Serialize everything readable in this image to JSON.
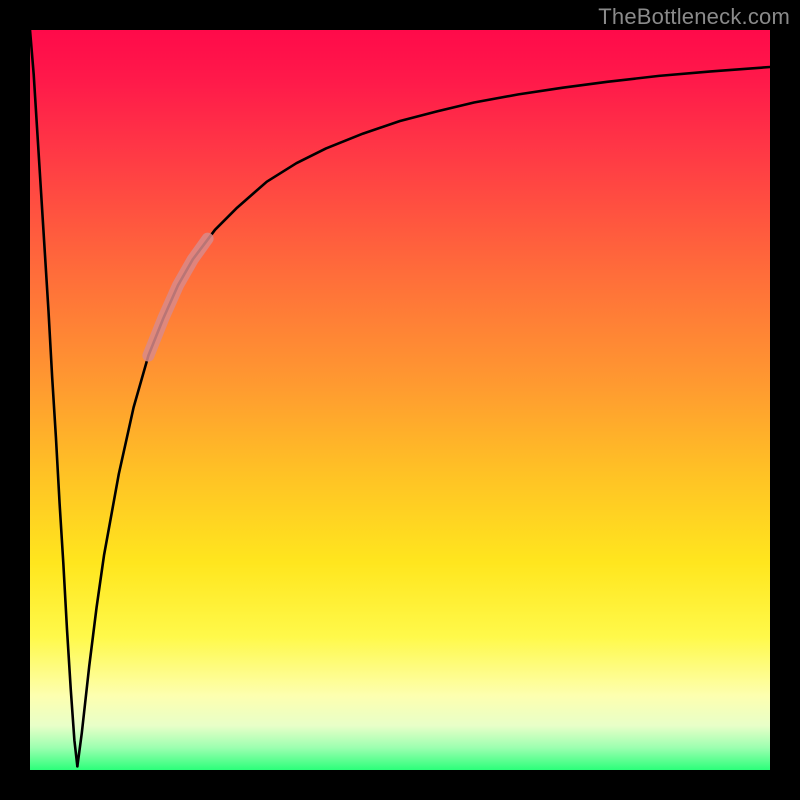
{
  "watermark": {
    "text": "TheBottleneck.com"
  },
  "chart_data": {
    "type": "line",
    "title": "",
    "xlabel": "",
    "ylabel": "",
    "xlim": [
      0,
      100
    ],
    "ylim": [
      0,
      100
    ],
    "grid": false,
    "legend": false,
    "series": [
      {
        "name": "left-branch",
        "x": [
          0,
          0.5,
          1,
          1.5,
          2,
          2.5,
          3,
          3.5,
          4,
          4.5,
          5,
          5.5,
          6,
          6.4
        ],
        "values": [
          100,
          94,
          86,
          78,
          70,
          62,
          53,
          45,
          36,
          28,
          19,
          11,
          4,
          0.5
        ],
        "color": "#000000"
      },
      {
        "name": "right-branch",
        "x": [
          6.4,
          7,
          8,
          9,
          10,
          12,
          14,
          16,
          18,
          20,
          22,
          25,
          28,
          32,
          36,
          40,
          45,
          50,
          55,
          60,
          66,
          72,
          78,
          85,
          92,
          100
        ],
        "values": [
          0.5,
          5,
          14,
          22,
          29,
          40,
          49,
          56,
          61,
          65.5,
          69,
          73,
          76,
          79.5,
          82,
          84,
          86,
          87.7,
          89,
          90.2,
          91.3,
          92.2,
          93,
          93.8,
          94.4,
          95
        ],
        "color": "#000000"
      },
      {
        "name": "highlight-segment",
        "x": [
          16,
          18,
          20,
          22,
          24
        ],
        "values": [
          56,
          61,
          65.5,
          69,
          71.8
        ],
        "color": "#d98a8a"
      }
    ],
    "background_gradient": {
      "direction": "vertical",
      "stops": [
        {
          "pos": 0.0,
          "color": "#ff0a4a"
        },
        {
          "pos": 0.33,
          "color": "#ff6d3a"
        },
        {
          "pos": 0.6,
          "color": "#ffc225"
        },
        {
          "pos": 0.82,
          "color": "#fff94a"
        },
        {
          "pos": 0.97,
          "color": "#9cffb0"
        },
        {
          "pos": 1.0,
          "color": "#2cff7a"
        }
      ]
    }
  }
}
